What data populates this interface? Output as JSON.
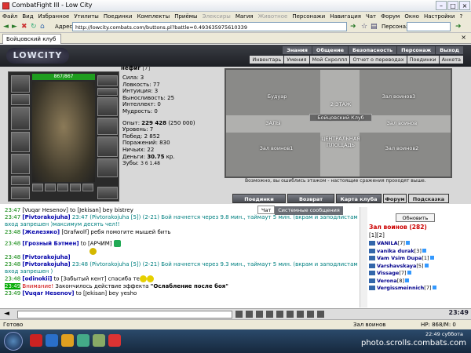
{
  "window": {
    "title": "CombatFight III - Low City"
  },
  "menu": [
    "Файл",
    "Вид",
    "Избранное",
    "Утилиты",
    "Поединки",
    "Комплекты",
    "Приёмы",
    "Элексиры",
    "Магия",
    "Животное",
    "Персонажи",
    "Навигация",
    "Чат",
    "Форум",
    "Окно",
    "Настройки",
    "?"
  ],
  "address": {
    "label": "Адрес:",
    "url": "http://lowcity.combats.com/buttons.pl?battle=0.493635975610339",
    "pers_label": "Персонаж:"
  },
  "tab": {
    "label": "Бойцовский клуб"
  },
  "game": {
    "logo": "LOWCITY",
    "nav_top": [
      "Знания",
      "Общение",
      "Безопасность",
      "Персонаж",
      "Выход"
    ],
    "nav_sub": [
      "Инвентарь",
      "Умения",
      "Мой Скроллл",
      "Отчет о переводах",
      "Поединки",
      "Анкета"
    ]
  },
  "character": {
    "name": "нефиг",
    "level": "[7]",
    "hp": "867/867",
    "hp_fraction": 1.0,
    "stats": [
      {
        "label": "Сила:",
        "value": "3"
      },
      {
        "label": "Ловкость:",
        "value": "77"
      },
      {
        "label": "Интуиция:",
        "value": "3"
      },
      {
        "label": "Выносливость:",
        "value": "25"
      },
      {
        "label": "Интеллект:",
        "value": "0"
      },
      {
        "label": "Мудрость:",
        "value": "0"
      }
    ],
    "exp_label": "Опыт:",
    "exp": "229 428",
    "exp_next": "(250 000)",
    "level_label": "Уровень:",
    "level_num": "7",
    "wins_label": "Побед:",
    "wins": "2 852",
    "losses_label": "Поражений:",
    "losses": "830",
    "draws_label": "Ничьих:",
    "draws": "22",
    "money_label": "Деньги:",
    "money": "30.75",
    "money_unit": "кр.",
    "teeth_label": "Зубы:",
    "teeth": "3  6  1.48"
  },
  "city": {
    "locations": [
      "Будуар",
      "Зал воинов3",
      "2 ЭТАЖ",
      "Бойцовский Клуб",
      "ЗАЛЫ",
      "Зал воинов",
      "ЦЕНТРАЛЬНАЯ ПЛОЩАДЬ",
      "Зал воинов1",
      "Зал воинов2"
    ],
    "message": "Возможно, вы ошиблись этажом - настоящие сражения проходят выше."
  },
  "buttons": [
    "Поединки",
    "Возврат",
    "Карта клуба",
    "Форум",
    "Подсказка"
  ],
  "chat_tabs": [
    "Чат",
    "Системные сообщения"
  ],
  "chat": [
    {
      "time": "23:47",
      "nick": "[Vuqar Hesenov]",
      "text": " to [Jekisan] bey bistrey"
    },
    {
      "time": "23:47",
      "nick": "[Pivtorakojuha]",
      "sys": " 23:47 (Pivtorakojuha [5]) (2-21) Бой начнется через 9.8 мин., таймаут 5 мин. (вкрам и заподлистам вход запрешен )максимум десять чел!!"
    },
    {
      "time": "23:48",
      "nick": "[Железяко]",
      "text": " [Grafwolf] ребя помогите мышей бить"
    },
    {
      "time": "23:48",
      "nick": "[Грозный Бэтмен]",
      "text": " to [АРЧИМ] "
    },
    {
      "time": "23:48",
      "nick": "[Pivtorakojuha]",
      "text": ""
    },
    {
      "time": "23:48",
      "nick": "[Pivtorakojuha]",
      "sys": " 23:48 (Pivtorakojuha [5]) (2-21) Бой начнется через 9.3 мин., таймаут 5 мин. (вкрам и заподлистам вход запрешен )"
    },
    {
      "time": "23:48",
      "nick": "[odinokii]",
      "text": " to [Забытый кент] спасиба те"
    },
    {
      "time": "23:49",
      "warn": "Внимание!",
      "text2": " Закончилось действие эффекта ",
      "bold": "\"Ослабление после боя\""
    },
    {
      "time": "23:49",
      "nick": "[Vuqar Hesenov]",
      "text": " to [Jekisan] bey yesho"
    }
  ],
  "room": {
    "refresh": "Обновить",
    "title": "Зал воинов (282)",
    "pages": "[1][2]",
    "players": [
      {
        "name": "VANILA",
        "level": "[7]"
      },
      {
        "name": "vanika durak",
        "level": "[3]"
      },
      {
        "name": "Vam Vsim Dupa",
        "level": "[1]"
      },
      {
        "name": "Varshavskaya",
        "level": "[5]"
      },
      {
        "name": "Vissage",
        "level": "[7]"
      },
      {
        "name": "Verona",
        "level": "[8]"
      },
      {
        "name": "Vergissmeinnich",
        "level": "[7]"
      }
    ]
  },
  "clock": "23:49",
  "status": {
    "ready": "Готово",
    "hp": "HP: 868/M: 0",
    "room": "Зал воинов"
  },
  "taskbar": {
    "time": "22:49",
    "day": "суббота",
    "watermark": "photo.scrolls.combats.com"
  },
  "colors": {
    "time": "#008000",
    "nick": "#0000aa",
    "system": "#008080",
    "warning": "#cc0000",
    "room_title": "#cc0000",
    "player": "#00008b"
  }
}
